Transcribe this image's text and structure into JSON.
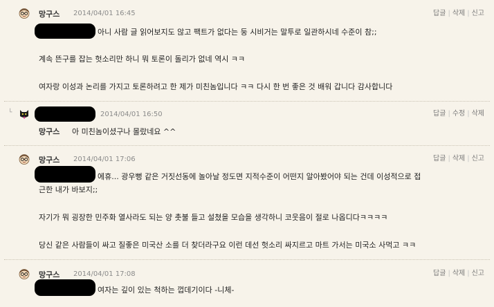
{
  "comments": [
    {
      "author": "망구스",
      "date": "2014/04/01 16:45",
      "actions": [
        "답글",
        "삭제",
        "신고"
      ],
      "lines": [
        "아니 사람 글 읽어보지도 않고 팩트가 없다는 둥 시비거는 말투로 일관하시네 수준이 참;;",
        "계속 뜬구를 잡는 헛소리만 하니 뭐 토론이 돌리가 없네 역시 ㅋㅋ",
        "여자랑 이성과 논리를 가지고 토론하려고 한 제가 미친놈입니다 ㅋㅋ 다시 한 번 좋은 것 배워 갑니다 감사합니다"
      ]
    },
    {
      "author": "",
      "date": "2014/04/01 16:50",
      "actions": [
        "답글",
        "수정",
        "삭제"
      ],
      "reply_author": "망구스",
      "lines": [
        "아 미친놈이셨구나 몰랐네요 ^^"
      ]
    },
    {
      "author": "망구스",
      "date": "2014/04/01 17:06",
      "actions": [
        "답글",
        "삭제",
        "신고"
      ],
      "lines": [
        "에휴... 광우뻥 같은 거짓선동에 놀아날 정도면 지적수준이 어떤지 알아봤어야 되는 건데 이성적으로 접",
        "근한 내가 바보지;;",
        "자기가 뭐 굉장한 민주화 열사라도 되는 양 촛불 들고 설쳤을 모습을 생각하니 코웃음이 절로 나옵디다ㅋㅋㅋㅋ",
        "당신 같은 사람들이 싸고 질좋은 미국산 소를 더 찾더라구요 이런 데선 헛소리 싸지르고 마트 가서는 미국소 사먹고 ㅋㅋ"
      ]
    },
    {
      "author": "망구스",
      "date": "2014/04/01 17:08",
      "actions": [
        "답글",
        "삭제",
        "신고"
      ],
      "lines": [
        "여자는 깊이 있는 척하는 껍데기이다 -니체-"
      ]
    }
  ]
}
